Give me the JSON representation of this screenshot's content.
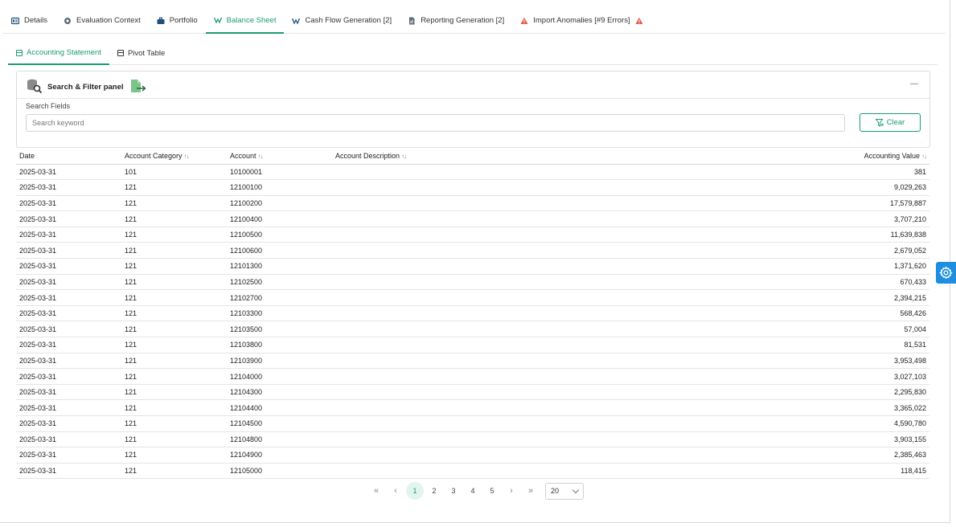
{
  "main_tabs": [
    {
      "label": "Details",
      "icon": "details-icon"
    },
    {
      "label": "Evaluation Context",
      "icon": "context-icon"
    },
    {
      "label": "Portfolio",
      "icon": "briefcase-icon"
    },
    {
      "label": "Balance Sheet",
      "icon": "balance-icon",
      "active": true
    },
    {
      "label": "Cash Flow Generation [2]",
      "icon": "cashflow-icon"
    },
    {
      "label": "Reporting Generation [2]",
      "icon": "report-icon"
    },
    {
      "label": "Import Anomalies [#9 Errors]",
      "icon": "warning-icon"
    }
  ],
  "sub_tabs": [
    {
      "label": "Accounting Statement",
      "active": true
    },
    {
      "label": "Pivot Table"
    }
  ],
  "filter_panel": {
    "title": "Search & Filter panel",
    "search_label": "Search Fields",
    "search_placeholder": "Search keyword",
    "search_value": "",
    "clear_label": "Clear"
  },
  "table": {
    "columns": [
      "Date",
      "Account Category",
      "Account",
      "Account Description",
      "Accounting Value"
    ],
    "rows": [
      [
        "2025-03-31",
        "101",
        "10100001",
        "",
        "381"
      ],
      [
        "2025-03-31",
        "121",
        "12100100",
        "",
        "9,029,263"
      ],
      [
        "2025-03-31",
        "121",
        "12100200",
        "",
        "17,579,887"
      ],
      [
        "2025-03-31",
        "121",
        "12100400",
        "",
        "3,707,210"
      ],
      [
        "2025-03-31",
        "121",
        "12100500",
        "",
        "11,639,838"
      ],
      [
        "2025-03-31",
        "121",
        "12100600",
        "",
        "2,679,052"
      ],
      [
        "2025-03-31",
        "121",
        "12101300",
        "",
        "1,371,620"
      ],
      [
        "2025-03-31",
        "121",
        "12102500",
        "",
        "670,433"
      ],
      [
        "2025-03-31",
        "121",
        "12102700",
        "",
        "2,394,215"
      ],
      [
        "2025-03-31",
        "121",
        "12103300",
        "",
        "568,426"
      ],
      [
        "2025-03-31",
        "121",
        "12103500",
        "",
        "57,004"
      ],
      [
        "2025-03-31",
        "121",
        "12103800",
        "",
        "81,531"
      ],
      [
        "2025-03-31",
        "121",
        "12103900",
        "",
        "3,953,498"
      ],
      [
        "2025-03-31",
        "121",
        "12104000",
        "",
        "3,027,103"
      ],
      [
        "2025-03-31",
        "121",
        "12104300",
        "",
        "2,295,830"
      ],
      [
        "2025-03-31",
        "121",
        "12104400",
        "",
        "3,365,022"
      ],
      [
        "2025-03-31",
        "121",
        "12104500",
        "",
        "4,590,780"
      ],
      [
        "2025-03-31",
        "121",
        "12104800",
        "",
        "3,903,155"
      ],
      [
        "2025-03-31",
        "121",
        "12104900",
        "",
        "2,385,463"
      ],
      [
        "2025-03-31",
        "121",
        "12105000",
        "",
        "118,415"
      ]
    ]
  },
  "pagination": {
    "first": "«",
    "prev": "‹",
    "pages": [
      "1",
      "2",
      "3",
      "4",
      "5"
    ],
    "current": "1",
    "next": "›",
    "last": "»",
    "page_size": "20"
  },
  "colors": {
    "accent": "#1a9b73",
    "warning": "#e35d4a",
    "settings": "#1e8fe0"
  }
}
